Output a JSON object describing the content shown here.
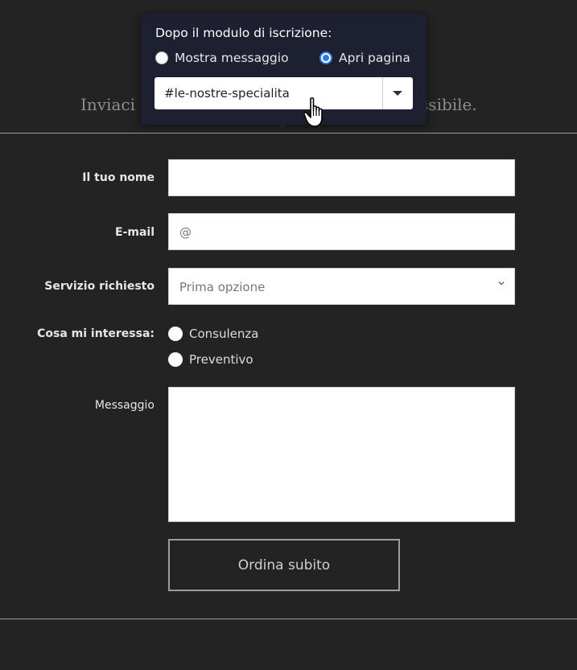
{
  "intro": {
    "left_text": "Inviaci i",
    "right_text": "ossibile."
  },
  "form": {
    "name_label": "Il tuo nome",
    "email_label": "E-mail",
    "email_placeholder": "@",
    "service_label": "Servizio richiesto",
    "service_selected": "Prima opzione",
    "interest_label": "Cosa mi interessa:",
    "interest_options": [
      "Consulenza",
      "Preventivo"
    ],
    "message_label": "Messaggio",
    "submit_label": "Ordina subito"
  },
  "popup": {
    "title": "Dopo il modulo di iscrizione:",
    "options": [
      {
        "label": "Mostra messaggio",
        "selected": false
      },
      {
        "label": "Apri pagina",
        "selected": true
      }
    ],
    "page_select_value": "#le-nostre-specialita"
  },
  "colors": {
    "background": "#232323",
    "popup_bg": "#1c2030",
    "accent": "#2a7ae2"
  }
}
